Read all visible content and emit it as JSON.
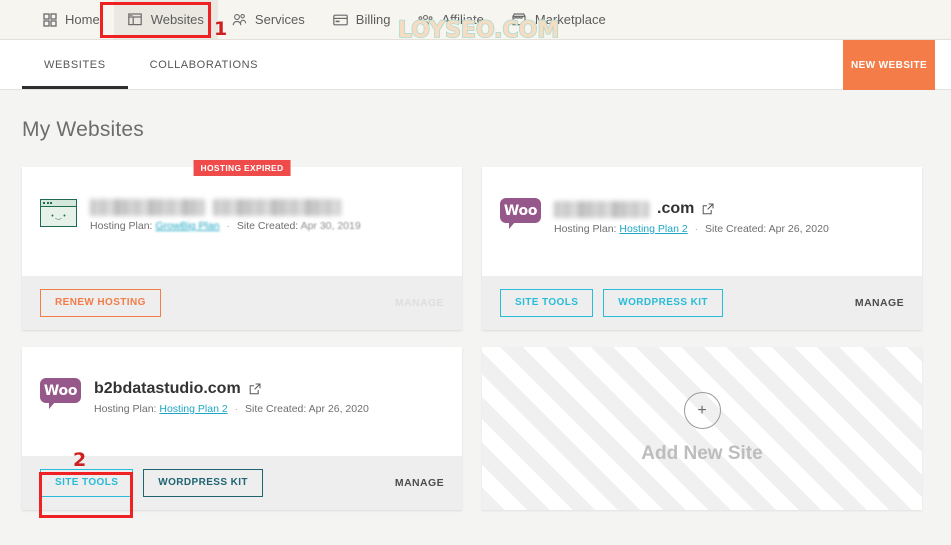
{
  "topnav": {
    "items": [
      {
        "label": "Home",
        "icon": "grid-icon",
        "active": false
      },
      {
        "label": "Websites",
        "icon": "websites-icon",
        "active": true
      },
      {
        "label": "Services",
        "icon": "services-icon",
        "active": false
      },
      {
        "label": "Billing",
        "icon": "billing-card-icon",
        "active": false
      },
      {
        "label": "Affiliate",
        "icon": "affiliate-people-icon",
        "active": false
      },
      {
        "label": "Marketplace",
        "icon": "marketplace-store-icon",
        "active": false
      }
    ]
  },
  "watermark": {
    "text": "LOYSEO.COM",
    "fill": "#f6dcc3",
    "stroke": "#a9dbd0"
  },
  "subnav": {
    "tabs": [
      {
        "label": "WEBSITES",
        "active": true
      },
      {
        "label": "COLLABORATIONS",
        "active": false
      }
    ],
    "new_website_label": "NEW WEBSITE",
    "new_website_color": "#f47c48"
  },
  "page": {
    "title": "My Websites"
  },
  "cards": [
    {
      "id": "card-expired",
      "badge": "HOSTING EXPIRED",
      "badge_color": "#f04b4b",
      "icon": "browser-screen-icon",
      "name_redacted": true,
      "name": "",
      "hosting_plan_label": "Hosting Plan:",
      "hosting_plan": "GrowBig Plan",
      "hosting_plan_redacted": true,
      "site_created_label": "Site Created:",
      "site_created": "Apr 30, 2019",
      "buttons": [
        {
          "label": "RENEW HOSTING",
          "style": "orange"
        }
      ],
      "manage_label": "MANAGE",
      "manage_disabled": true
    },
    {
      "id": "card-woo-redacted",
      "badge": null,
      "icon": "woocommerce-icon",
      "name_redacted": true,
      "name_suffix": ".com",
      "hosting_plan_label": "Hosting Plan:",
      "hosting_plan": "Hosting Plan 2",
      "hosting_plan_redacted": false,
      "site_created_label": "Site Created:",
      "site_created": "Apr 26, 2020",
      "buttons": [
        {
          "label": "SITE TOOLS",
          "style": "teal"
        },
        {
          "label": "WORDPRESS KIT",
          "style": "teal"
        }
      ],
      "manage_label": "MANAGE",
      "manage_disabled": false
    },
    {
      "id": "card-b2bdatastudio",
      "badge": null,
      "icon": "woocommerce-icon",
      "name_redacted": false,
      "name": "b2bdatastudio.com",
      "hosting_plan_label": "Hosting Plan:",
      "hosting_plan": "Hosting Plan 2",
      "hosting_plan_redacted": false,
      "site_created_label": "Site Created:",
      "site_created": "Apr 26, 2020",
      "buttons": [
        {
          "label": "SITE TOOLS",
          "style": "teal"
        },
        {
          "label": "WORDPRESS KIT",
          "style": "teal-dark"
        }
      ],
      "manage_label": "MANAGE",
      "manage_disabled": false
    }
  ],
  "add_card": {
    "plus": "+",
    "label": "Add New Site"
  },
  "annotations": [
    {
      "number": "1",
      "target": "websites-nav-tab"
    },
    {
      "number": "2",
      "target": "site-tools-button"
    }
  ],
  "woo_text": "Woo"
}
